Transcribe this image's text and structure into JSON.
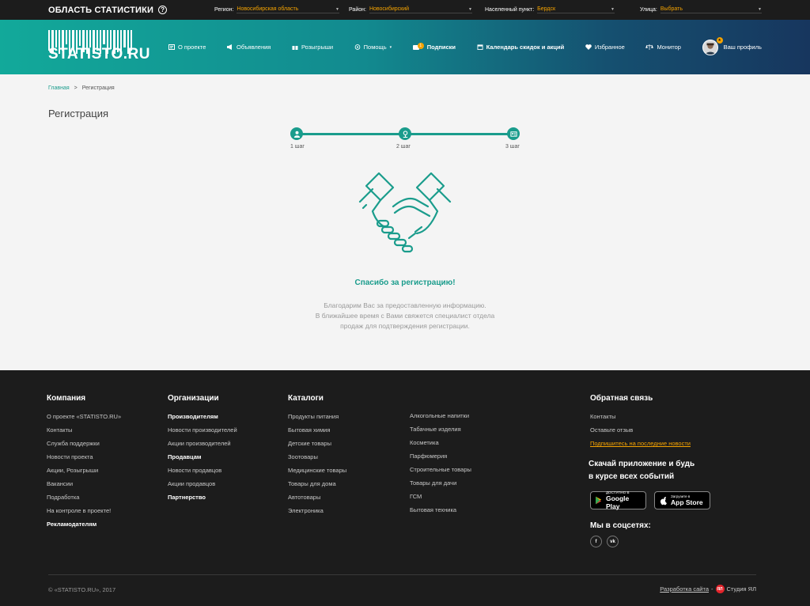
{
  "topbar": {
    "title": "ОБЛАСТЬ СТАТИСТИКИ",
    "filters": [
      {
        "label": "Регион:",
        "value": "Новосибирская область"
      },
      {
        "label": "Район:",
        "value": "Новосибирский"
      },
      {
        "label": "Населенный пункт:",
        "value": "Бердск"
      },
      {
        "label": "Улица:",
        "value": "Выбрать"
      }
    ]
  },
  "header": {
    "logo_text": "STATISTO.RU",
    "nav": [
      {
        "label": "О проекте",
        "icon": "info-card-icon"
      },
      {
        "label": "Объявления",
        "icon": "megaphone-icon"
      },
      {
        "label": "Розыгрыши",
        "icon": "gift-icon"
      },
      {
        "label": "Помощь",
        "icon": "help-icon"
      },
      {
        "label": "Подписки",
        "icon": "subscriptions-icon",
        "badge": "1"
      },
      {
        "label": "Календарь скидок и акций",
        "icon": "calendar-icon"
      },
      {
        "label": "Избранное",
        "icon": "heart-icon"
      },
      {
        "label": "Монитор",
        "icon": "scales-icon"
      },
      {
        "label": "Ваш профиль",
        "icon": "avatar"
      }
    ]
  },
  "breadcrumb": {
    "home": "Главная",
    "separator": ">",
    "current": "Регистрация"
  },
  "page_title": "Регистрация",
  "steps": [
    {
      "label": "1 шаг"
    },
    {
      "label": "2 шаг"
    },
    {
      "label": "3 шаг"
    }
  ],
  "success": {
    "title": "Спасибо за регистрацию!",
    "line1": "Благодарим Вас за предоставленную информацию.",
    "line2": "В ближайшее время с Вами свяжется специалист отдела",
    "line3": "продаж для подтверждения регистрации."
  },
  "footer": {
    "company": {
      "title": "Компания",
      "links": [
        "О проекте «STATISTO.RU»",
        "Контакты",
        "Служба поддержки",
        "Новости проекта",
        "Акции, Розыгрыши",
        "Вакансии",
        "Подработка",
        "На контроле в проекте!",
        "Рекламодателям"
      ]
    },
    "organizations": {
      "title": "Организации",
      "links": [
        "Производителям",
        "Новости производителей",
        "Акции производителей",
        "Продавцам",
        "Новости продавцов",
        "Акции продавцов",
        "Партнерство"
      ]
    },
    "catalogs": {
      "title": "Каталоги",
      "col1": [
        "Продукты питания",
        "Бытовая химия",
        "Детские товары",
        "Зоотовары",
        "Медицинские товары",
        "Товары для дома",
        "Автотовары",
        "Электроника"
      ],
      "col2": [
        "Алкогольные напитки",
        "Табачные изделия",
        "Косметика",
        "Парфюмерия",
        "Строительные товары",
        "Товары для дачи",
        "ГСМ",
        "Бытовая техника"
      ]
    },
    "feedback": {
      "title": "Обратная связь",
      "links": [
        "Контакты",
        "Оставьте отзыв",
        "Подпишитесь на последние новости"
      ]
    },
    "app": {
      "title_line1": "Скачай приложение и будь",
      "title_line2": "в курсе всех событий",
      "google_small": "ДОСТУПНО В",
      "google_big": "Google Play",
      "apple_small": "Загрузите в",
      "apple_big": "App Store"
    },
    "social": {
      "title": "Мы в соцсетях:",
      "fb": "f",
      "vk": "vk"
    },
    "copyright": "© «STATISTO.RU», 2017",
    "dev_link": "Разработка сайта",
    "dev_dash": "-",
    "studio_logo": "ЯЛ",
    "studio": "Студия ЯЛ"
  }
}
